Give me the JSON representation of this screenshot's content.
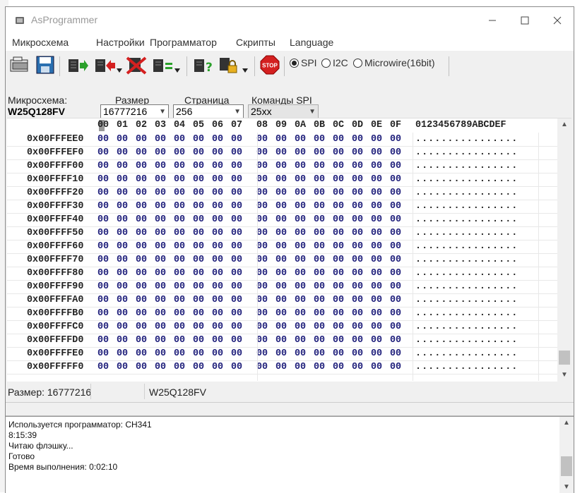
{
  "window": {
    "title": "AsProgrammer"
  },
  "menu": [
    "Микросхема",
    "Настройки",
    "Программатор",
    "Скрипты",
    "Language"
  ],
  "interface": {
    "options": [
      "SPI",
      "I2C",
      "Microwire(16bit)"
    ],
    "selected": "SPI"
  },
  "fields": {
    "chip_label": "Микросхема:",
    "chip_name": "W25Q128FV",
    "size_label": "Размер",
    "size_value": "16777216",
    "page_label": "Страница",
    "page_value": "256",
    "spi_label": "Команды SPI",
    "spi_value": "25xx"
  },
  "hex": {
    "columns": [
      "00",
      "01",
      "02",
      "03",
      "04",
      "05",
      "06",
      "07",
      "08",
      "09",
      "0A",
      "0B",
      "0C",
      "0D",
      "0E",
      "0F"
    ],
    "ascii_header": "0123456789ABCDEF",
    "rows": [
      {
        "addr": "0x00FFFEE0",
        "bytes": [
          "00",
          "00",
          "00",
          "00",
          "00",
          "00",
          "00",
          "00",
          "00",
          "00",
          "00",
          "00",
          "00",
          "00",
          "00",
          "00"
        ],
        "ascii": "................"
      },
      {
        "addr": "0x00FFFEF0",
        "bytes": [
          "00",
          "00",
          "00",
          "00",
          "00",
          "00",
          "00",
          "00",
          "00",
          "00",
          "00",
          "00",
          "00",
          "00",
          "00",
          "00"
        ],
        "ascii": "................"
      },
      {
        "addr": "0x00FFFF00",
        "bytes": [
          "00",
          "00",
          "00",
          "00",
          "00",
          "00",
          "00",
          "00",
          "00",
          "00",
          "00",
          "00",
          "00",
          "00",
          "00",
          "00"
        ],
        "ascii": "................"
      },
      {
        "addr": "0x00FFFF10",
        "bytes": [
          "00",
          "00",
          "00",
          "00",
          "00",
          "00",
          "00",
          "00",
          "00",
          "00",
          "00",
          "00",
          "00",
          "00",
          "00",
          "00"
        ],
        "ascii": "................"
      },
      {
        "addr": "0x00FFFF20",
        "bytes": [
          "00",
          "00",
          "00",
          "00",
          "00",
          "00",
          "00",
          "00",
          "00",
          "00",
          "00",
          "00",
          "00",
          "00",
          "00",
          "00"
        ],
        "ascii": "................"
      },
      {
        "addr": "0x00FFFF30",
        "bytes": [
          "00",
          "00",
          "00",
          "00",
          "00",
          "00",
          "00",
          "00",
          "00",
          "00",
          "00",
          "00",
          "00",
          "00",
          "00",
          "00"
        ],
        "ascii": "................"
      },
      {
        "addr": "0x00FFFF40",
        "bytes": [
          "00",
          "00",
          "00",
          "00",
          "00",
          "00",
          "00",
          "00",
          "00",
          "00",
          "00",
          "00",
          "00",
          "00",
          "00",
          "00"
        ],
        "ascii": "................"
      },
      {
        "addr": "0x00FFFF50",
        "bytes": [
          "00",
          "00",
          "00",
          "00",
          "00",
          "00",
          "00",
          "00",
          "00",
          "00",
          "00",
          "00",
          "00",
          "00",
          "00",
          "00"
        ],
        "ascii": "................"
      },
      {
        "addr": "0x00FFFF60",
        "bytes": [
          "00",
          "00",
          "00",
          "00",
          "00",
          "00",
          "00",
          "00",
          "00",
          "00",
          "00",
          "00",
          "00",
          "00",
          "00",
          "00"
        ],
        "ascii": "................"
      },
      {
        "addr": "0x00FFFF70",
        "bytes": [
          "00",
          "00",
          "00",
          "00",
          "00",
          "00",
          "00",
          "00",
          "00",
          "00",
          "00",
          "00",
          "00",
          "00",
          "00",
          "00"
        ],
        "ascii": "................"
      },
      {
        "addr": "0x00FFFF80",
        "bytes": [
          "00",
          "00",
          "00",
          "00",
          "00",
          "00",
          "00",
          "00",
          "00",
          "00",
          "00",
          "00",
          "00",
          "00",
          "00",
          "00"
        ],
        "ascii": "................"
      },
      {
        "addr": "0x00FFFF90",
        "bytes": [
          "00",
          "00",
          "00",
          "00",
          "00",
          "00",
          "00",
          "00",
          "00",
          "00",
          "00",
          "00",
          "00",
          "00",
          "00",
          "00"
        ],
        "ascii": "................"
      },
      {
        "addr": "0x00FFFFA0",
        "bytes": [
          "00",
          "00",
          "00",
          "00",
          "00",
          "00",
          "00",
          "00",
          "00",
          "00",
          "00",
          "00",
          "00",
          "00",
          "00",
          "00"
        ],
        "ascii": "................"
      },
      {
        "addr": "0x00FFFFB0",
        "bytes": [
          "00",
          "00",
          "00",
          "00",
          "00",
          "00",
          "00",
          "00",
          "00",
          "00",
          "00",
          "00",
          "00",
          "00",
          "00",
          "00"
        ],
        "ascii": "................"
      },
      {
        "addr": "0x00FFFFC0",
        "bytes": [
          "00",
          "00",
          "00",
          "00",
          "00",
          "00",
          "00",
          "00",
          "00",
          "00",
          "00",
          "00",
          "00",
          "00",
          "00",
          "00"
        ],
        "ascii": "................"
      },
      {
        "addr": "0x00FFFFD0",
        "bytes": [
          "00",
          "00",
          "00",
          "00",
          "00",
          "00",
          "00",
          "00",
          "00",
          "00",
          "00",
          "00",
          "00",
          "00",
          "00",
          "00"
        ],
        "ascii": "................"
      },
      {
        "addr": "0x00FFFFE0",
        "bytes": [
          "00",
          "00",
          "00",
          "00",
          "00",
          "00",
          "00",
          "00",
          "00",
          "00",
          "00",
          "00",
          "00",
          "00",
          "00",
          "00"
        ],
        "ascii": "................"
      },
      {
        "addr": "0x00FFFFF0",
        "bytes": [
          "00",
          "00",
          "00",
          "00",
          "00",
          "00",
          "00",
          "00",
          "00",
          "00",
          "00",
          "00",
          "00",
          "00",
          "00",
          "00"
        ],
        "ascii": "................"
      }
    ]
  },
  "status": {
    "size": "Размер: 16777216",
    "chip": "W25Q128FV"
  },
  "log": [
    "Используется программатор: CH341",
    "8:15:39",
    "Читаю флэшку...",
    "Готово",
    "Время выполнения: 0:02:10"
  ],
  "icons": {
    "open": "open-file-icon",
    "save": "save-file-icon",
    "read": "read-chip-icon",
    "write": "write-chip-icon",
    "erase": "erase-chip-icon",
    "verify": "verify-chip-icon",
    "id": "read-id-icon",
    "lock": "lock-icon",
    "stop": "stop-icon"
  },
  "stop_label": "STOP",
  "colors": {
    "byte": "#1d1d7a",
    "stop": "#d42020",
    "green_arrow": "#2aa02a",
    "red_arrow": "#d42020"
  }
}
